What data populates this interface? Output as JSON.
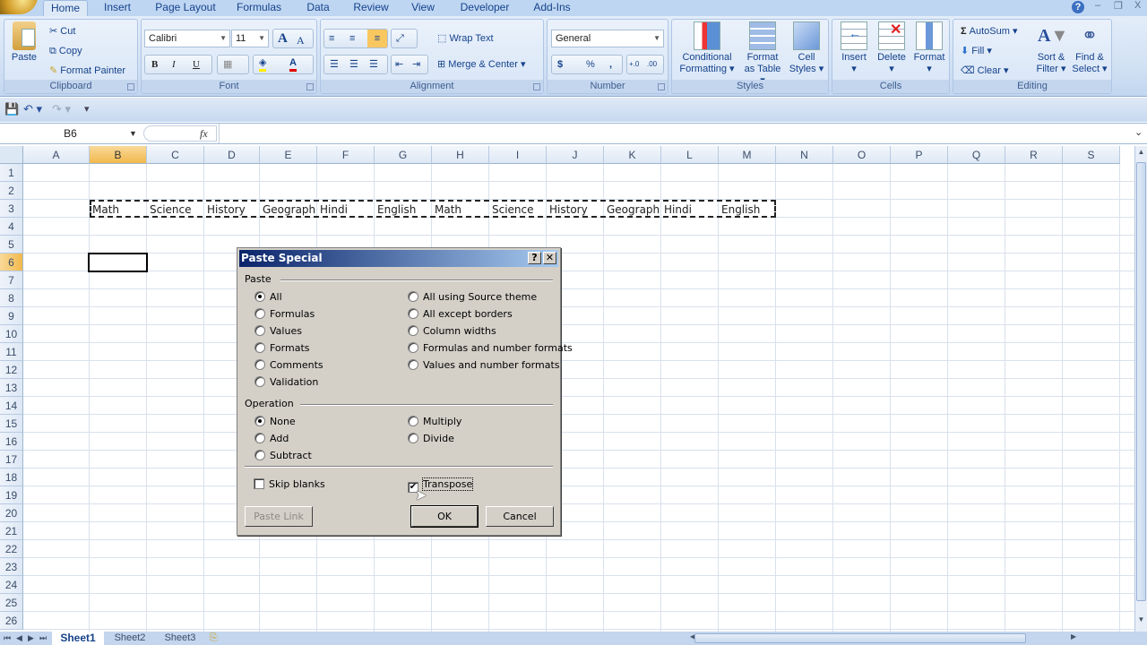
{
  "ribbon_tabs": [
    "Home",
    "Insert",
    "Page Layout",
    "Formulas",
    "Data",
    "Review",
    "View",
    "Developer",
    "Add-Ins"
  ],
  "active_tab": "Home",
  "window_controls": {
    "help": "?",
    "minimize": "–",
    "restore": "❐",
    "close": "X"
  },
  "clipboard": {
    "paste": "Paste",
    "cut": "Cut",
    "copy": "Copy",
    "format_painter": "Format Painter",
    "label": "Clipboard"
  },
  "font": {
    "name": "Calibri",
    "size": "11",
    "bold": "B",
    "italic": "I",
    "underline": "U",
    "grow": "A",
    "shrink": "A",
    "label": "Font"
  },
  "alignment": {
    "wrap_text": "Wrap Text",
    "merge_center": "Merge & Center",
    "label": "Alignment"
  },
  "number": {
    "format": "General",
    "currency": "$",
    "percent": "%",
    "comma": ",",
    "inc_decimal": "+.0",
    "dec_decimal": ".00",
    "label": "Number"
  },
  "styles": {
    "conditional": "Conditional",
    "conditional2": "Formatting",
    "format_table": "Format",
    "format_table2": "as Table",
    "cell_styles": "Cell",
    "cell_styles2": "Styles",
    "label": "Styles"
  },
  "cells": {
    "insert": "Insert",
    "delete": "Delete",
    "format": "Format",
    "label": "Cells"
  },
  "editing": {
    "autosum": "AutoSum",
    "fill": "Fill",
    "clear": "Clear",
    "sort": "Sort &",
    "sort2": "Filter",
    "find": "Find &",
    "find2": "Select",
    "label": "Editing"
  },
  "formula_bar": {
    "name_box": "B6",
    "fx": "fx",
    "formula": ""
  },
  "columns": [
    "A",
    "B",
    "C",
    "D",
    "E",
    "F",
    "G",
    "H",
    "I",
    "J",
    "K",
    "L",
    "M",
    "N",
    "O",
    "P",
    "Q",
    "R",
    "S"
  ],
  "selected_column": "B",
  "rows": [
    "1",
    "2",
    "3",
    "4",
    "5",
    "6",
    "7",
    "8",
    "9",
    "10",
    "11",
    "12",
    "13",
    "14",
    "15",
    "16",
    "17",
    "18",
    "19",
    "20",
    "21",
    "22",
    "23",
    "24",
    "25",
    "26"
  ],
  "row3_values": [
    "Math",
    "Science",
    "History",
    "Geograph",
    "Hindi",
    "English",
    "Math",
    "Science",
    "History",
    "Geograph",
    "Hindi",
    "English"
  ],
  "active_cell": "B6",
  "sheets": [
    "Sheet1",
    "Sheet2",
    "Sheet3"
  ],
  "active_sheet": "Sheet1",
  "dialog": {
    "title": "Paste Special",
    "help": "?",
    "close": "✕",
    "paste_label": "Paste",
    "paste_options_left": [
      "All",
      "Formulas",
      "Values",
      "Formats",
      "Comments",
      "Validation"
    ],
    "paste_options_right": [
      "All using Source theme",
      "All except borders",
      "Column widths",
      "Formulas and number formats",
      "Values and number formats"
    ],
    "paste_selected": "All",
    "operation_label": "Operation",
    "operation_left": [
      "None",
      "Add",
      "Subtract"
    ],
    "operation_right": [
      "Multiply",
      "Divide"
    ],
    "operation_selected": "None",
    "skip_blanks": "Skip blanks",
    "skip_blanks_checked": false,
    "transpose": "Transpose",
    "transpose_checked": true,
    "paste_link": "Paste Link",
    "ok": "OK",
    "cancel": "Cancel"
  }
}
